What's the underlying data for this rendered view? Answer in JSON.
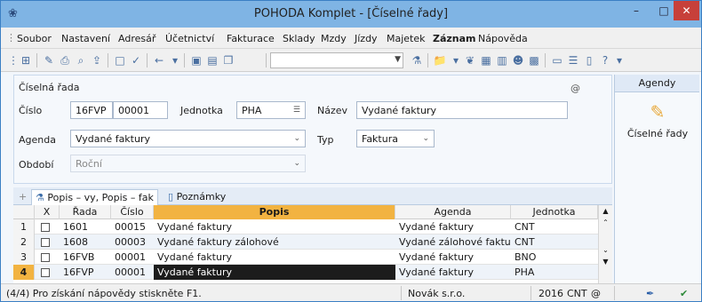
{
  "window": {
    "title": "POHODA Komplet - [Číselné řady]",
    "min_label": "–",
    "max_label": "□",
    "close_label": "✕"
  },
  "menu": {
    "items": [
      "Soubor",
      "Nastavení",
      "Adresář",
      "Účetnictví",
      "Fakturace",
      "Sklady",
      "Mzdy",
      "Jízdy",
      "Majetek",
      "Záznam",
      "Nápověda"
    ]
  },
  "form": {
    "section_title": "Číselná řada",
    "cislo_label": "Číslo",
    "cislo_prefix": "16FVP",
    "cislo_number": "00001",
    "jednotka_label": "Jednotka",
    "jednotka_value": "PHA",
    "nazev_label": "Název",
    "nazev_value": "Vydané faktury",
    "agenda_label": "Agenda",
    "agenda_value": "Vydané faktury",
    "typ_label": "Typ",
    "typ_value": "Faktura",
    "obdobi_label": "Období",
    "obdobi_value": "Roční",
    "at_symbol": "@"
  },
  "agendy": {
    "header": "Agendy",
    "item_label": "Číselné řady"
  },
  "tabs": {
    "tab1": "Popis – vy, Popis – fak",
    "tab2": "Poznámky"
  },
  "grid": {
    "columns": [
      "X",
      "Řada",
      "Číslo",
      "Popis",
      "Agenda",
      "Jednotka"
    ],
    "rows": [
      {
        "num": "1",
        "rada": "1601",
        "cislo": "00015",
        "popis": "Vydané faktury",
        "agenda": "Vydané faktury",
        "jednotka": "CNT"
      },
      {
        "num": "2",
        "rada": "1608",
        "cislo": "00003",
        "popis": "Vydané faktury zálohové",
        "agenda": "Vydané zálohové faktury",
        "jednotka": "CNT"
      },
      {
        "num": "3",
        "rada": "16FVB",
        "cislo": "00001",
        "popis": "Vydané faktury",
        "agenda": "Vydané faktury",
        "jednotka": "BNO"
      },
      {
        "num": "4",
        "rada": "16FVP",
        "cislo": "00001",
        "popis": "Vydané faktury",
        "agenda": "Vydané faktury",
        "jednotka": "PHA"
      }
    ]
  },
  "status": {
    "hint": "(4/4) Pro získání nápovědy stiskněte F1.",
    "company": "Novák s.r.o.",
    "year": "2016",
    "unit": "CNT",
    "at": "@"
  },
  "colors": {
    "titlebar": "#7fb4e4",
    "selected_header": "#f2b341",
    "selected_cell": "#1c1c1c",
    "close_button": "#c7403a"
  }
}
